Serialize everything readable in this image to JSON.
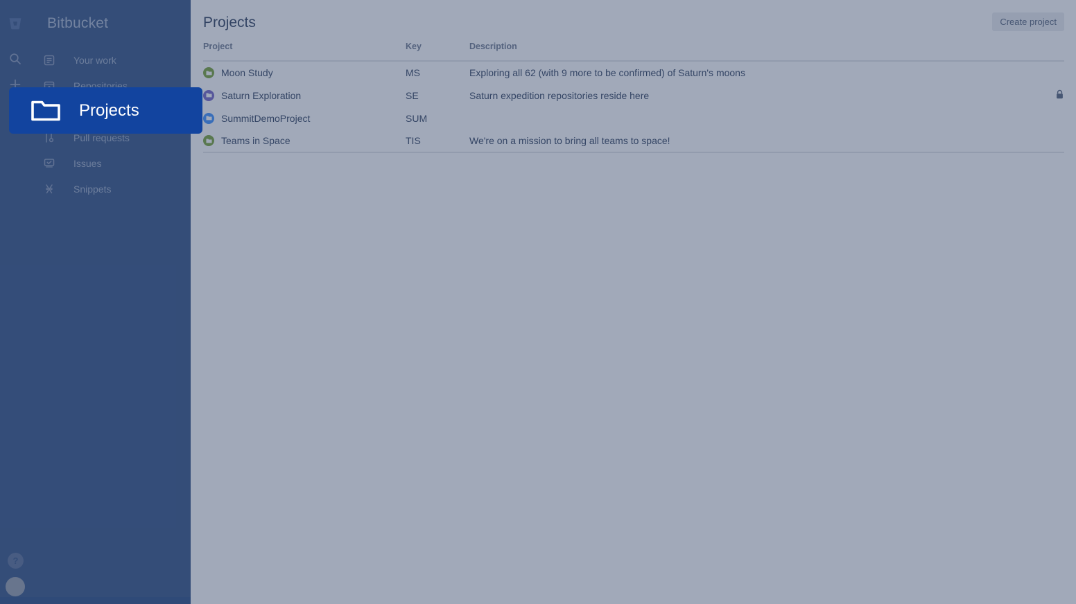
{
  "sidebar": {
    "logo": {
      "icon": "bitbucket-logo-icon",
      "text": "Bitbucket"
    },
    "rail": [
      {
        "name": "search-icon",
        "label": "Search"
      },
      {
        "name": "create-icon",
        "label": "Create"
      }
    ],
    "items": [
      {
        "icon": "your-work-icon",
        "label": "Your work"
      },
      {
        "icon": "repositories-icon",
        "label": "Repositories"
      },
      {
        "icon": "projects-icon",
        "label": "Projects"
      },
      {
        "icon": "pull-requests-icon",
        "label": "Pull requests"
      },
      {
        "icon": "issues-icon",
        "label": "Issues"
      },
      {
        "icon": "snippets-icon",
        "label": "Snippets"
      }
    ],
    "help": {
      "icon": "help-icon",
      "label": "?"
    },
    "avatar": {
      "icon": "avatar-icon",
      "label": ""
    },
    "background_color": "#1c3f78"
  },
  "header": {
    "title": "Projects",
    "create_button": "Create project"
  },
  "table": {
    "columns": [
      "Project",
      "Key",
      "Description",
      ""
    ],
    "rows": [
      {
        "avatar_color": "#6a9a23",
        "project": "Moon Study",
        "key": "MS",
        "description": "Exploring all 62 (with 9 more to be confirmed) of Saturn's moons",
        "lock": ""
      },
      {
        "avatar_color": "#6554c0",
        "project": "Saturn Exploration",
        "key": "SE",
        "description": "Saturn expedition repositories reside here",
        "lock": "lock-icon"
      },
      {
        "avatar_color": "#2684ff",
        "project": "SummitDemoProject",
        "key": "SUM",
        "description": "",
        "lock": ""
      },
      {
        "avatar_color": "#6a9a23",
        "project": "Teams in Space",
        "key": "TIS",
        "description": "We're on a mission to bring all teams to space!",
        "lock": ""
      }
    ]
  },
  "spotlight": {
    "icon": "folder-icon",
    "label": "Projects",
    "background_color": "#12449f"
  },
  "colors": {
    "sidebar": "#1c3f78",
    "spotlight": "#12449f",
    "dim_overlay": "#4a5a79",
    "text_primary": "#172b4d",
    "text_subtle": "#5e6c84"
  }
}
